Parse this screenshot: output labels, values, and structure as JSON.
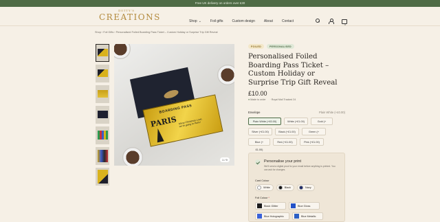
{
  "promo": "Free UK delivery on orders over £30",
  "brand": {
    "small": "DOTTY'S",
    "big": "CREATIONS",
    "color": "#b38a3d"
  },
  "nav": [
    {
      "label": "Shop",
      "caret": "⌄"
    },
    {
      "label": "Foil gifts"
    },
    {
      "label": "Custom design"
    },
    {
      "label": "About"
    },
    {
      "label": "Contact"
    }
  ],
  "header_icons": [
    "search-icon",
    "user-icon",
    "cart-icon"
  ],
  "cart_count": "0",
  "breadcrumb": "Shop  ›  Foil Gifts  ›  Personalised Foiled Boarding Pass Ticket – Custom Holiday or Surprise Trip Gift Reveal",
  "gallery": {
    "counter": "1 / 9",
    "ticket_heading": "BOARDING PASS",
    "ticket_city": "PARIS",
    "ticket_message": "Merry Christmas Love, we're going to Paris!"
  },
  "product": {
    "badges": [
      "FOILED",
      "PERSONALISED"
    ],
    "title": "Personalised Foiled Boarding Pass Ticket – Custom Holiday or Surprise Trip Gift Reveal",
    "price": "£10.00",
    "made_to_order": "Made to order",
    "shipping": "Royal Mail Tracked 24"
  },
  "envelope": {
    "label": "Envelope",
    "selected_value": "Plain White (+£0.00)",
    "options": [
      {
        "label": "Plain White (+£0.00)",
        "selected": true,
        "w": "w1"
      },
      {
        "label": "White (+£1.00)",
        "w": "w3"
      },
      {
        "label": "Gold (+£1.00)",
        "w": "w2"
      },
      {
        "label": "Silver (+£1.00)",
        "w": "w3"
      },
      {
        "label": "Black (+£1.00)",
        "w": "w3"
      },
      {
        "label": "Green (+£1.00)",
        "w": "w3"
      },
      {
        "label": "Blue (+£1.00)",
        "w": "w2"
      },
      {
        "label": "Red (+£1.00)",
        "w": "w3"
      },
      {
        "label": "Pink (+£1.00)",
        "w": "w3"
      }
    ]
  },
  "personalise": {
    "title": "Personalise your print",
    "description": "We'll send a digital proof to your email before anything is printed. You can ask for changes.",
    "card_colour_label": "Card Colour",
    "card_colours": [
      {
        "label": "White",
        "color": "#ffffff"
      },
      {
        "label": "Black",
        "color": "#111111"
      },
      {
        "label": "Navy",
        "color": "#1d2a6b"
      }
    ],
    "foil_colour_label": "Foil Colour",
    "required_mark": "*",
    "foils": [
      {
        "label": "Black Glitter",
        "color": "#1b1b1b"
      },
      {
        "label": "Blue Gloss",
        "color": "#2251c8"
      },
      {
        "label": "Blue Holographic",
        "color": "#3a62d8"
      },
      {
        "label": "Blue Metallic",
        "color": "#2c5fc4"
      }
    ]
  }
}
